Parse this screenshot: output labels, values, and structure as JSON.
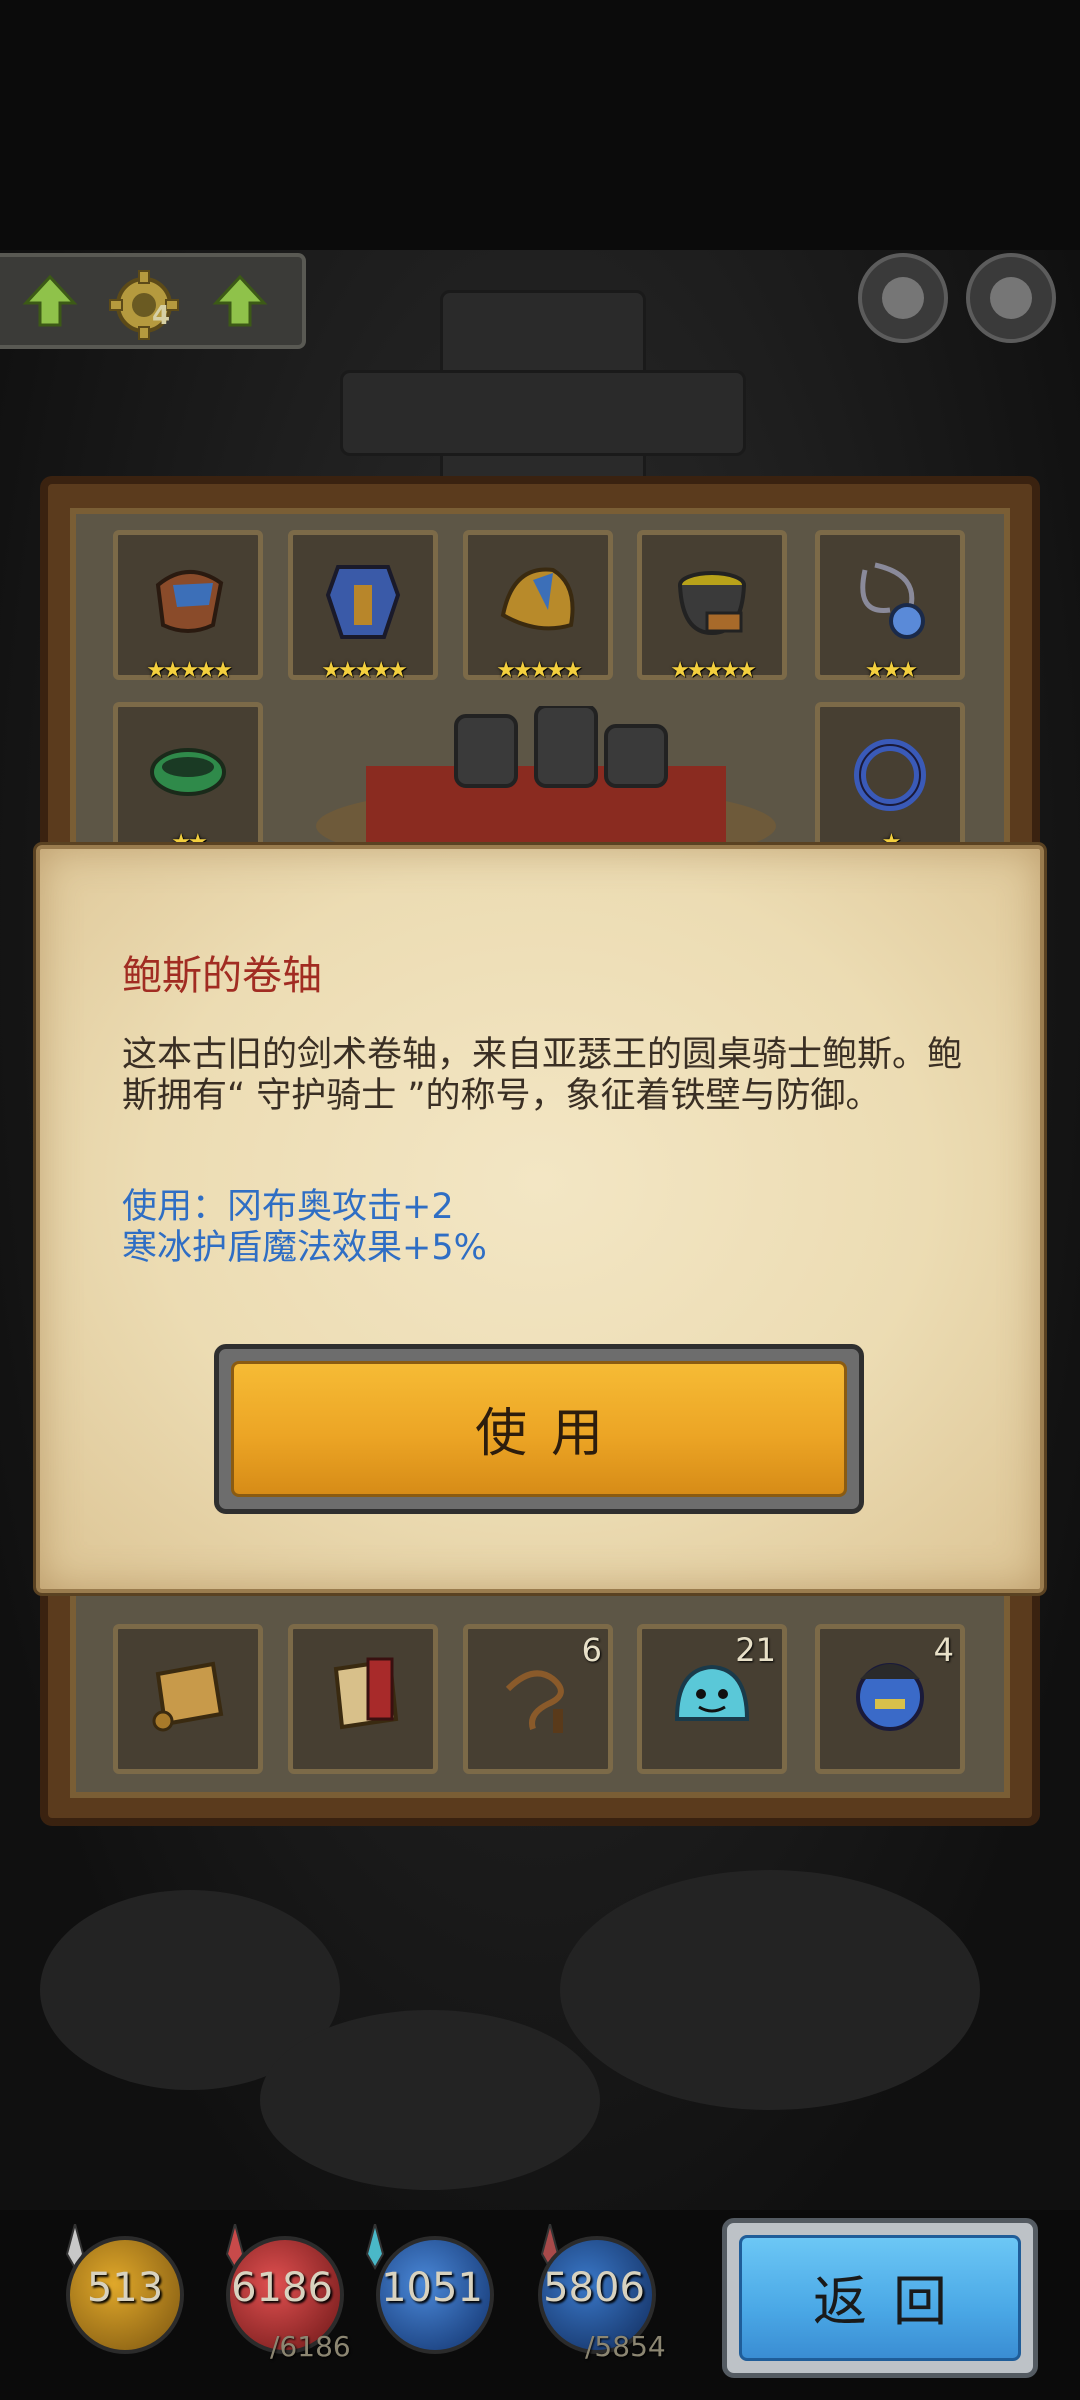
{
  "topbar": {
    "gear_level": "4"
  },
  "inventory": {
    "row1": [
      {
        "icon": "pauldron-icon",
        "stars": "★★★★★"
      },
      {
        "icon": "armor-icon",
        "stars": "★★★★★"
      },
      {
        "icon": "winged-helmet-icon",
        "stars": "★★★★★"
      },
      {
        "icon": "cauldron-icon",
        "stars": "★★★★★"
      },
      {
        "icon": "amulet-icon",
        "stars": "★★★"
      }
    ],
    "row2": [
      {
        "icon": "green-bracelet-icon",
        "stars": "★★"
      },
      {
        "icon": "blue-ring-icon",
        "stars": "★"
      }
    ],
    "bottom": [
      {
        "icon": "scroll-icon",
        "count": ""
      },
      {
        "icon": "red-scroll-icon",
        "count": ""
      },
      {
        "icon": "whip-icon",
        "count": "6"
      },
      {
        "icon": "blue-slime-icon",
        "count": "21"
      },
      {
        "icon": "hero-portrait-icon",
        "count": "4"
      }
    ]
  },
  "modal": {
    "title": "鲍斯的卷轴",
    "desc": "这本古旧的剑术卷轴，来自亚瑟王的圆桌骑士鲍斯。鲍斯拥有“ 守护骑士 ”的称号，象征着铁壁与防御。",
    "effect_line1": "使用：冈布奥攻击+2",
    "effect_line2": "寒冰护盾魔法效果+5%",
    "use_label": "使用"
  },
  "resources": {
    "attack": "513",
    "hp": "6186",
    "hp_max": "/6186",
    "magic": "1051",
    "mp": "5806",
    "mp_max": "/5854"
  },
  "back_label": "返回"
}
